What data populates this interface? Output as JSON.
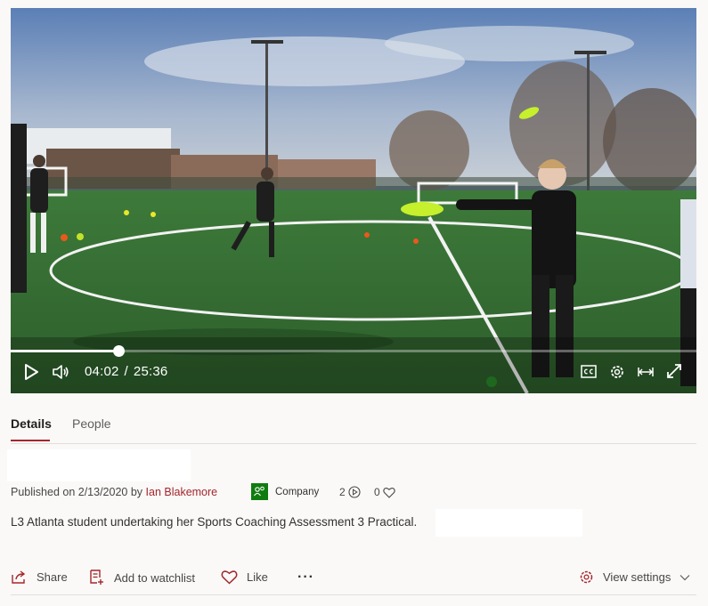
{
  "player": {
    "current_time": "04:02",
    "separator": "/",
    "duration": "25:36",
    "progress": 0.157
  },
  "tabs": [
    {
      "label": "Details",
      "active": true
    },
    {
      "label": "People",
      "active": false
    }
  ],
  "meta": {
    "published_prefix": "Published on 2/13/2020 by",
    "author": "Ian Blakemore",
    "visibility": "Company",
    "views": "2",
    "likes": "0"
  },
  "description": "L3 Atlanta student undertaking her Sports Coaching Assessment 3 Practical.",
  "actions": {
    "share": "Share",
    "watchlist": "Add to watchlist",
    "like": "Like",
    "more": "···",
    "view_settings": "View settings"
  },
  "colors": {
    "accent": "#a4262c",
    "company_badge": "#107c10",
    "background": "#faf9f8"
  }
}
